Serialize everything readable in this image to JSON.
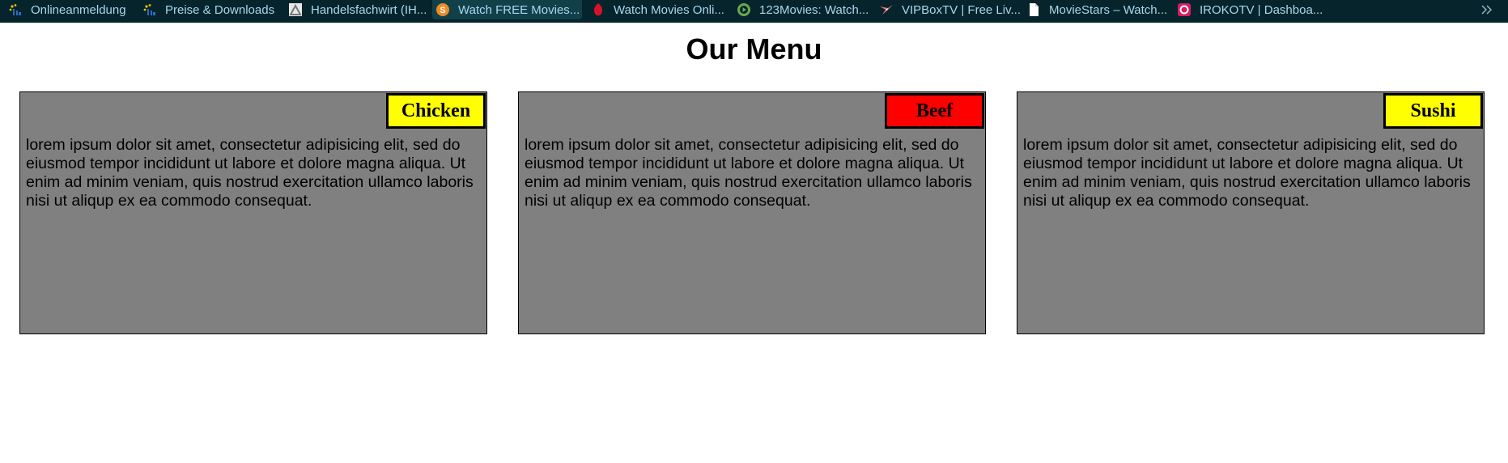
{
  "bookmarks": [
    {
      "label": "Onlineanmeldung",
      "icon": "ihk-logo-icon"
    },
    {
      "label": "Preise & Downloads",
      "icon": "ihk-logo-icon"
    },
    {
      "label": "Handelsfachwirt (IH...",
      "icon": "building-logo-icon"
    },
    {
      "label": "Watch FREE Movies...",
      "icon": "s-logo-icon"
    },
    {
      "label": "Watch Movies Onli...",
      "icon": "red-drop-icon"
    },
    {
      "label": "123Movies: Watch...",
      "icon": "play-circle-icon"
    },
    {
      "label": "VIPBoxTV | Free Liv...",
      "icon": "bird-logo-icon"
    },
    {
      "label": "MovieStars – Watch...",
      "icon": "document-icon"
    },
    {
      "label": "IROKOTV | Dashboa...",
      "icon": "iroko-logo-icon"
    }
  ],
  "overflow_icon": "double-chevron-right-icon",
  "page": {
    "title": "Our Menu"
  },
  "menu": [
    {
      "name": "Chicken",
      "badge_color": "#ffff00",
      "description": "lorem ipsum dolor sit amet, consectetur adipisicing elit, sed do eiusmod tempor incididunt ut labore et dolore magna aliqua. Ut enim ad minim veniam, quis nostrud exercitation ullamco laboris nisi ut aliqup ex ea commodo consequat."
    },
    {
      "name": "Beef",
      "badge_color": "#ff0000",
      "description": "lorem ipsum dolor sit amet, consectetur adipisicing elit, sed do eiusmod tempor incididunt ut labore et dolore magna aliqua. Ut enim ad minim veniam, quis nostrud exercitation ullamco laboris nisi ut aliqup ex ea commodo consequat."
    },
    {
      "name": "Sushi",
      "badge_color": "#ffff00",
      "description": "lorem ipsum dolor sit amet, consectetur adipisicing elit, sed do eiusmod tempor incididunt ut labore et dolore magna aliqua. Ut enim ad minim veniam, quis nostrud exercitation ullamco laboris nisi ut aliqup ex ea commodo consequat."
    }
  ],
  "colors": {
    "bookmarks_bar_bg": "#06242b",
    "card_bg": "#808080"
  }
}
